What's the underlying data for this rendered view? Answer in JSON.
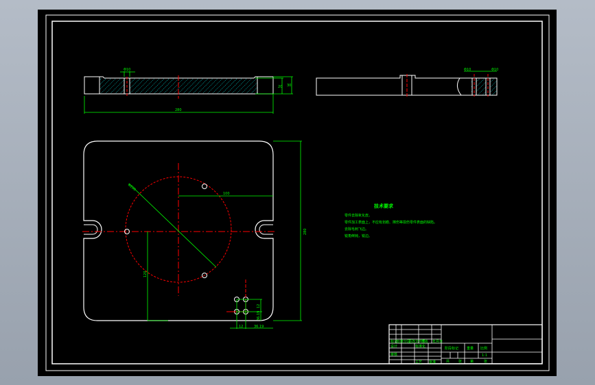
{
  "colors": {
    "outline": "#ffffff",
    "dimension": "#00ff00",
    "centerline": "#ff0000",
    "hatch": "#00ffff",
    "background": "#000000"
  },
  "dimensions": {
    "top_hole_dia": "Φ10",
    "top_length": "280",
    "top_thk1": "20",
    "top_thk2": "30",
    "side_hole1": "Φ10",
    "side_hole2": "Φ10",
    "circle_dia": "Φ200",
    "offset_x": "100",
    "offset_y": "120",
    "plate_height": "280",
    "hole_pitch_v1": "12",
    "hole_pitch_v2": "36.19",
    "hole_pitch_h1": "12",
    "hole_pitch_h2": "36.19"
  },
  "tech_requirements": {
    "title": "技术要求",
    "items": [
      "零件去除氧化皮。",
      "零件加工表面上，不应有划痕、擦伤等损伤零件表面的缺陷。",
      "去除毛刺飞边。",
      "锐角倒钝，锐边。"
    ]
  },
  "title_block": {
    "mark": "标记",
    "count": "处数",
    "zone": "分区",
    "change_doc": "更改文件号",
    "sign": "签名",
    "date": "年月日",
    "design": "设计",
    "standard": "标准化",
    "stage": "阶段标记",
    "weight": "重量",
    "scale": "比例",
    "scale_value": "1:1",
    "review": "审核",
    "process": "工艺",
    "approve": "批准",
    "total": "共",
    "sheets": "张",
    "no": "第",
    "sheet": "张"
  }
}
